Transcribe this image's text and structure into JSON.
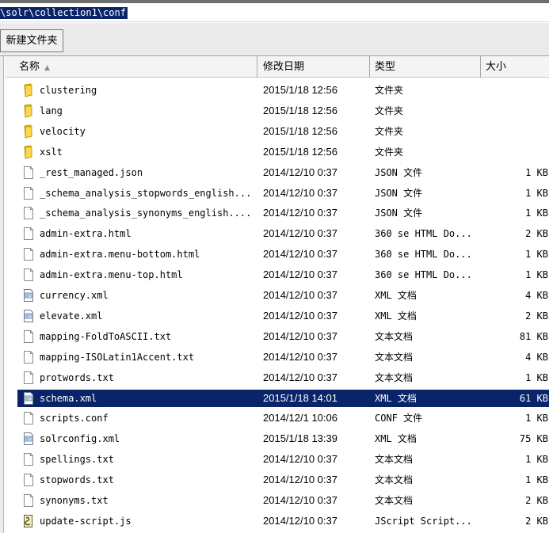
{
  "address": {
    "path": "\\solr\\collection1\\conf"
  },
  "toolbar": {
    "new_folder_label": "新建文件夹"
  },
  "columns": {
    "name": "名称",
    "date": "修改日期",
    "type": "类型",
    "size": "大小"
  },
  "files": [
    {
      "name": "clustering",
      "date": "2015/1/18 12:56",
      "type": "文件夹",
      "size": "",
      "icon": "folder-icon"
    },
    {
      "name": "lang",
      "date": "2015/1/18 12:56",
      "type": "文件夹",
      "size": "",
      "icon": "folder-icon"
    },
    {
      "name": "velocity",
      "date": "2015/1/18 12:56",
      "type": "文件夹",
      "size": "",
      "icon": "folder-icon"
    },
    {
      "name": "xslt",
      "date": "2015/1/18 12:56",
      "type": "文件夹",
      "size": "",
      "icon": "folder-icon"
    },
    {
      "name": "_rest_managed.json",
      "date": "2014/12/10 0:37",
      "type": "JSON 文件",
      "size": "1 KB",
      "icon": "file-icon"
    },
    {
      "name": "_schema_analysis_stopwords_english...",
      "date": "2014/12/10 0:37",
      "type": "JSON 文件",
      "size": "1 KB",
      "icon": "file-icon"
    },
    {
      "name": "_schema_analysis_synonyms_english....",
      "date": "2014/12/10 0:37",
      "type": "JSON 文件",
      "size": "1 KB",
      "icon": "file-icon"
    },
    {
      "name": "admin-extra.html",
      "date": "2014/12/10 0:37",
      "type": "360 se HTML Do...",
      "size": "2 KB",
      "icon": "file-icon"
    },
    {
      "name": "admin-extra.menu-bottom.html",
      "date": "2014/12/10 0:37",
      "type": "360 se HTML Do...",
      "size": "1 KB",
      "icon": "file-icon"
    },
    {
      "name": "admin-extra.menu-top.html",
      "date": "2014/12/10 0:37",
      "type": "360 se HTML Do...",
      "size": "1 KB",
      "icon": "file-icon"
    },
    {
      "name": "currency.xml",
      "date": "2014/12/10 0:37",
      "type": "XML 文档",
      "size": "4 KB",
      "icon": "xml-file-icon"
    },
    {
      "name": "elevate.xml",
      "date": "2014/12/10 0:37",
      "type": "XML 文档",
      "size": "2 KB",
      "icon": "xml-file-icon"
    },
    {
      "name": "mapping-FoldToASCII.txt",
      "date": "2014/12/10 0:37",
      "type": "文本文档",
      "size": "81 KB",
      "icon": "text-file-icon"
    },
    {
      "name": "mapping-ISOLatin1Accent.txt",
      "date": "2014/12/10 0:37",
      "type": "文本文档",
      "size": "4 KB",
      "icon": "text-file-icon"
    },
    {
      "name": "protwords.txt",
      "date": "2014/12/10 0:37",
      "type": "文本文档",
      "size": "1 KB",
      "icon": "text-file-icon"
    },
    {
      "name": "schema.xml",
      "date": "2015/1/18 14:01",
      "type": "XML 文档",
      "size": "61 KB",
      "icon": "xml-file-icon",
      "selected": true
    },
    {
      "name": "scripts.conf",
      "date": "2014/12/1 10:06",
      "type": "CONF 文件",
      "size": "1 KB",
      "icon": "file-icon"
    },
    {
      "name": "solrconfig.xml",
      "date": "2015/1/18 13:39",
      "type": "XML 文档",
      "size": "75 KB",
      "icon": "xml-file-icon"
    },
    {
      "name": "spellings.txt",
      "date": "2014/12/10 0:37",
      "type": "文本文档",
      "size": "1 KB",
      "icon": "text-file-icon"
    },
    {
      "name": "stopwords.txt",
      "date": "2014/12/10 0:37",
      "type": "文本文档",
      "size": "1 KB",
      "icon": "text-file-icon"
    },
    {
      "name": "synonyms.txt",
      "date": "2014/12/10 0:37",
      "type": "文本文档",
      "size": "2 KB",
      "icon": "text-file-icon"
    },
    {
      "name": "update-script.js",
      "date": "2014/12/10 0:37",
      "type": "JScript Script...",
      "size": "2 KB",
      "icon": "script-file-icon"
    }
  ],
  "colors": {
    "selection": "#0a246a",
    "folder": "#e8b400"
  }
}
